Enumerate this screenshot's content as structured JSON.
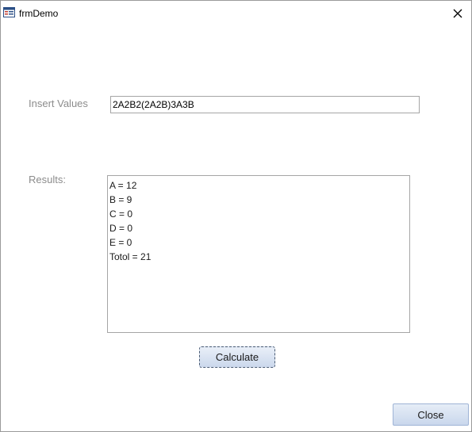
{
  "window": {
    "title": "frmDemo"
  },
  "form": {
    "insert_label": "Insert Values",
    "insert_value": "2A2B2(2A2B)3A3B",
    "results_label": "Results:",
    "results_lines": [
      "A = 12",
      "B = 9",
      "C = 0",
      "D = 0",
      "E = 0",
      "Totol = 21"
    ]
  },
  "buttons": {
    "calculate_label": "Calculate",
    "close_label": "Close"
  },
  "icons": {
    "form_icon": "form-icon",
    "close_icon": "close-x-icon"
  },
  "colors": {
    "label_gray": "#8c8c8c",
    "button_blue": "#cbd8ec"
  }
}
